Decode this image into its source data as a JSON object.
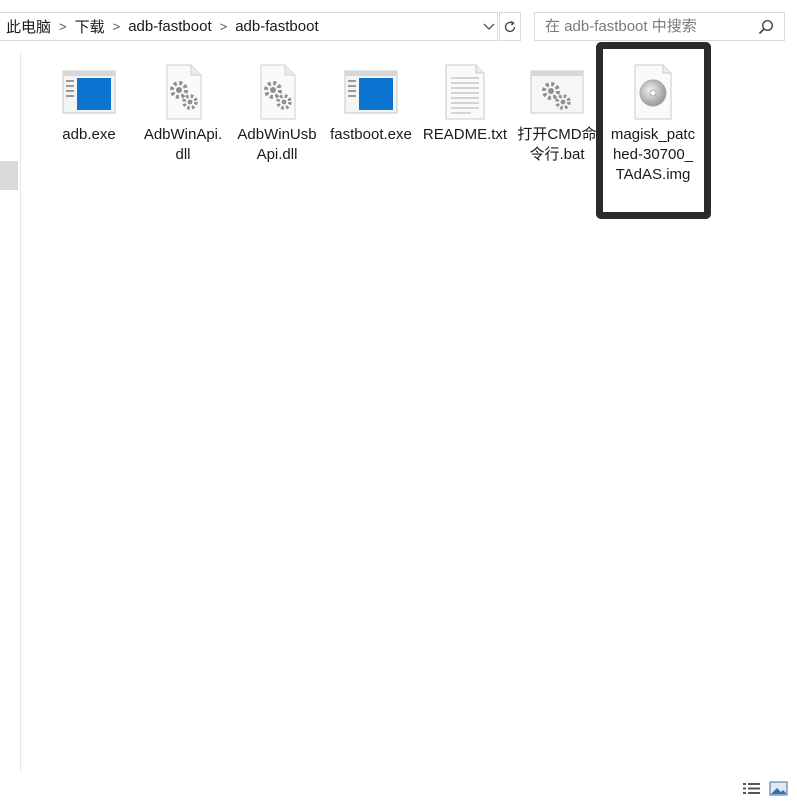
{
  "address": {
    "crumbs": [
      "此电脑",
      "下载",
      "adb-fastboot",
      "adb-fastboot"
    ]
  },
  "search": {
    "placeholder": "在 adb-fastboot 中搜索"
  },
  "files": [
    {
      "name": "adb.exe",
      "icon": "exe-window-icon"
    },
    {
      "name": "AdbWinApi.dll",
      "icon": "dll-gear-icon"
    },
    {
      "name": "AdbWinUsbApi.dll",
      "icon": "dll-gear-icon"
    },
    {
      "name": "fastboot.exe",
      "icon": "exe-window-icon"
    },
    {
      "name": "README.txt",
      "icon": "text-document-icon"
    },
    {
      "name": "打开CMD命令行.bat",
      "icon": "batch-gear-icon"
    },
    {
      "name": "magisk_patched-30700_TAdAS.img",
      "icon": "disc-image-icon"
    }
  ],
  "colors": {
    "accent": "#0b74d1",
    "highlight_border": "#2b2b2b"
  }
}
